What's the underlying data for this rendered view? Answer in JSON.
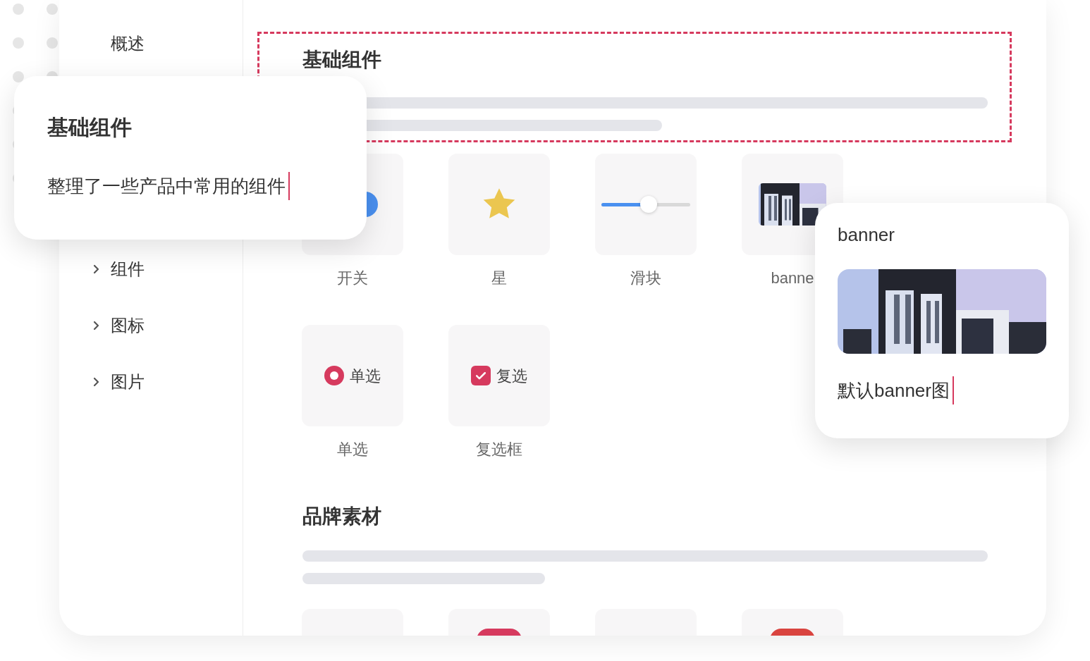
{
  "sidebar": {
    "items": [
      {
        "label": "概述",
        "kind": "link"
      },
      {
        "label": "组件",
        "kind": "group"
      },
      {
        "label": "图标",
        "kind": "group"
      },
      {
        "label": "图片",
        "kind": "group"
      }
    ]
  },
  "sections": [
    {
      "title": "基础组件",
      "highlighted": true,
      "rows": [
        [
          {
            "kind": "switch",
            "label": "开关",
            "on": true
          },
          {
            "kind": "star",
            "label": "星"
          },
          {
            "kind": "slider",
            "label": "滑块",
            "level": 0.53
          },
          {
            "kind": "picture",
            "label": "banne"
          }
        ],
        [
          {
            "kind": "radio",
            "label": "单选",
            "text": "单选",
            "selected": true
          },
          {
            "kind": "checkbox",
            "label": "复选框",
            "text": "复选",
            "checked": true
          }
        ]
      ]
    },
    {
      "title": "品牌素材",
      "highlighted": false,
      "rows": [
        [
          {
            "kind": "empty"
          },
          {
            "kind": "pill",
            "color": "#d63a5e"
          },
          {
            "kind": "empty"
          },
          {
            "kind": "pill",
            "color": "#d9443f"
          }
        ]
      ]
    }
  ],
  "popovers": [
    {
      "kind": "text",
      "title": "基础组件",
      "text": "整理了一些产品中常用的组件"
    },
    {
      "kind": "picture",
      "title": "banner",
      "text": "默认banner图"
    }
  ]
}
